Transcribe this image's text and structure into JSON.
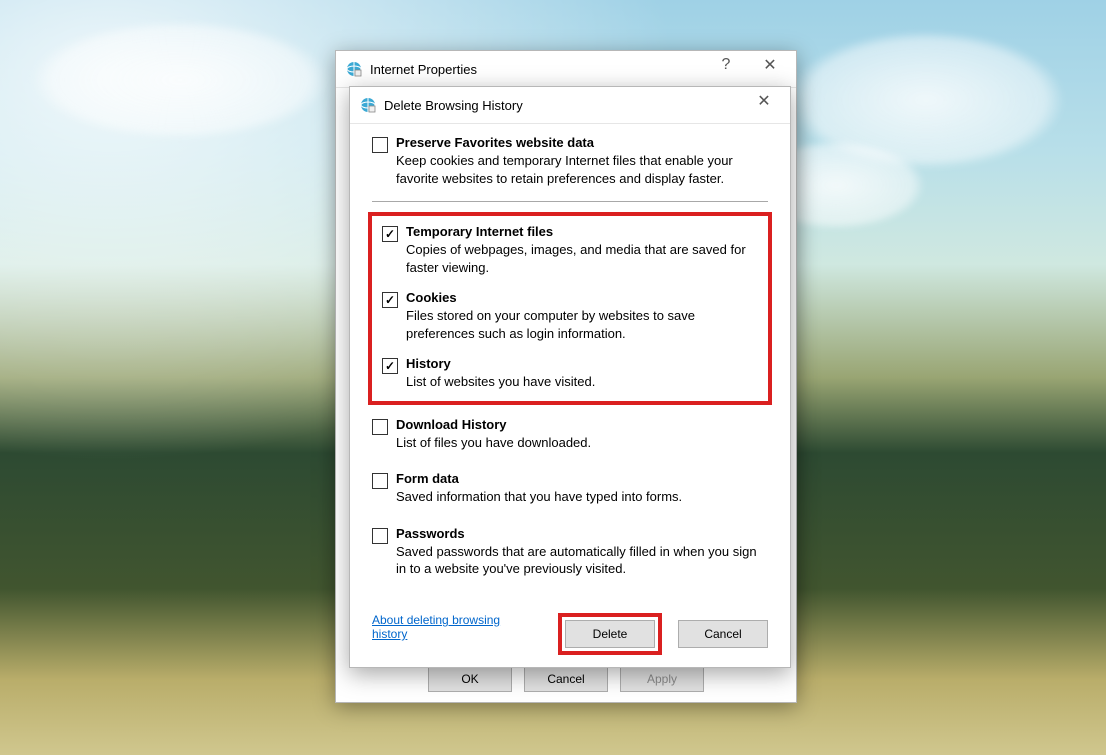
{
  "parent": {
    "title": "Internet Properties",
    "buttons": {
      "ok": "OK",
      "cancel": "Cancel",
      "apply": "Apply"
    }
  },
  "dialog": {
    "title": "Delete Browsing History",
    "options": {
      "preserve": {
        "label": "Preserve Favorites website data",
        "desc": "Keep cookies and temporary Internet files that enable your favorite websites to retain preferences and display faster.",
        "checked": false
      },
      "temp": {
        "label": "Temporary Internet files",
        "desc": "Copies of webpages, images, and media that are saved for faster viewing.",
        "checked": true
      },
      "cookies": {
        "label": "Cookies",
        "desc": "Files stored on your computer by websites to save preferences such as login information.",
        "checked": true
      },
      "history": {
        "label": "History",
        "desc": "List of websites you have visited.",
        "checked": true
      },
      "download": {
        "label": "Download History",
        "desc": "List of files you have downloaded.",
        "checked": false
      },
      "form": {
        "label": "Form data",
        "desc": "Saved information that you have typed into forms.",
        "checked": false
      },
      "passwords": {
        "label": "Passwords",
        "desc": "Saved passwords that are automatically filled in when you sign in to a website you've previously visited.",
        "checked": false
      }
    },
    "link": "About deleting browsing history",
    "buttons": {
      "delete": "Delete",
      "cancel": "Cancel"
    }
  }
}
